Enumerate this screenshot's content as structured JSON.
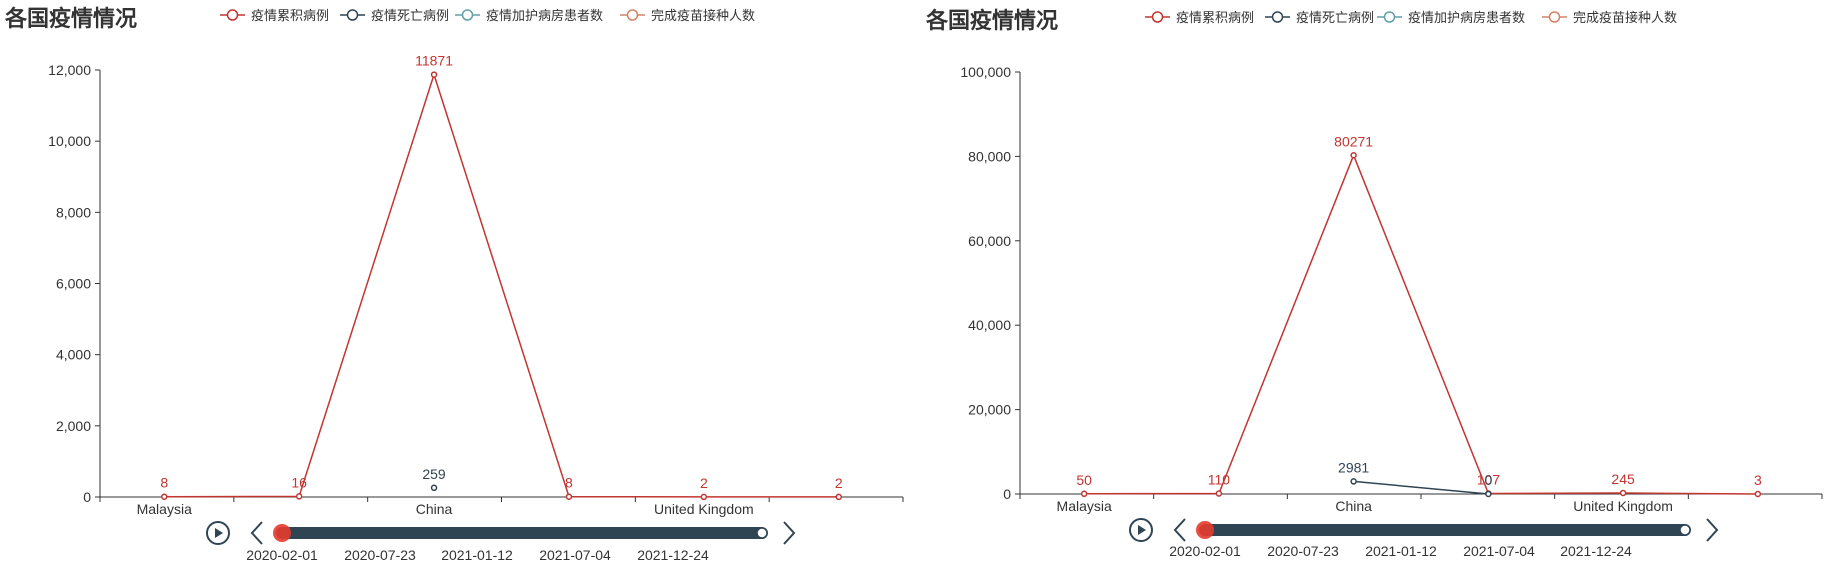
{
  "colors": {
    "cases": "#c23531",
    "deaths": "#2f4554",
    "icu": "#61a0a8",
    "vaccinated": "#d48265",
    "axis": "#333333",
    "timeline_track": "#2f4554",
    "timeline_thumb": "#e63b2e"
  },
  "legend": [
    "疫情累积病例",
    "疫情死亡病例",
    "疫情加护病房患者数",
    "完成疫苗接种人数"
  ],
  "timeline": {
    "dates": [
      "2020-02-01",
      "2020-07-23",
      "2021-01-12",
      "2021-07-04",
      "2021-12-24"
    ],
    "current": "2020-02-01",
    "play_icon": "play-icon",
    "prev_icon": "chevron-left-icon",
    "next_icon": "chevron-right-icon"
  },
  "chart_data": [
    {
      "type": "line",
      "title": "各国疫情情况",
      "categories": [
        "",
        "Malaysia",
        "",
        "China",
        "",
        "United Kingdom",
        ""
      ],
      "category_labels_shown": [
        "Malaysia",
        "China",
        "United Kingdom"
      ],
      "yticks": [
        "0",
        "2,000",
        "4,000",
        "6,000",
        "8,000",
        "10,000",
        "12,000"
      ],
      "ylim": [
        0,
        12000
      ],
      "series": [
        {
          "name": "疫情累积病例",
          "points": [
            8,
            16,
            11871,
            8,
            2,
            2
          ],
          "labels": [
            "8",
            "16",
            "11871",
            "8",
            "2",
            "2"
          ]
        },
        {
          "name": "疫情死亡病例",
          "points": [
            null,
            null,
            259,
            null,
            null,
            null
          ],
          "labels": [
            "",
            "",
            "259",
            "",
            "",
            ""
          ]
        },
        {
          "name": "疫情加护病房患者数",
          "points": [],
          "labels": []
        },
        {
          "name": "完成疫苗接种人数",
          "points": [],
          "labels": []
        }
      ]
    },
    {
      "type": "line",
      "title": "各国疫情情况",
      "categories": [
        "",
        "Malaysia",
        "",
        "China",
        "",
        "United Kingdom",
        ""
      ],
      "category_labels_shown": [
        "Malaysia",
        "China",
        "United Kingdom"
      ],
      "yticks": [
        "0",
        "20,000",
        "40,000",
        "60,000",
        "80,000",
        "100,000"
      ],
      "ylim": [
        0,
        100000
      ],
      "series": [
        {
          "name": "疫情累积病例",
          "points": [
            50,
            110,
            80271,
            107,
            245,
            3
          ],
          "labels": [
            "50",
            "110",
            "80271",
            "107",
            "245",
            "3"
          ]
        },
        {
          "name": "疫情死亡病例",
          "points": [
            null,
            null,
            2981,
            0,
            null,
            null
          ],
          "labels": [
            "",
            "",
            "2981",
            "0",
            "",
            ""
          ]
        },
        {
          "name": "疫情加护病房患者数",
          "points": [],
          "labels": []
        },
        {
          "name": "完成疫苗接种人数",
          "points": [],
          "labels": []
        }
      ]
    }
  ]
}
